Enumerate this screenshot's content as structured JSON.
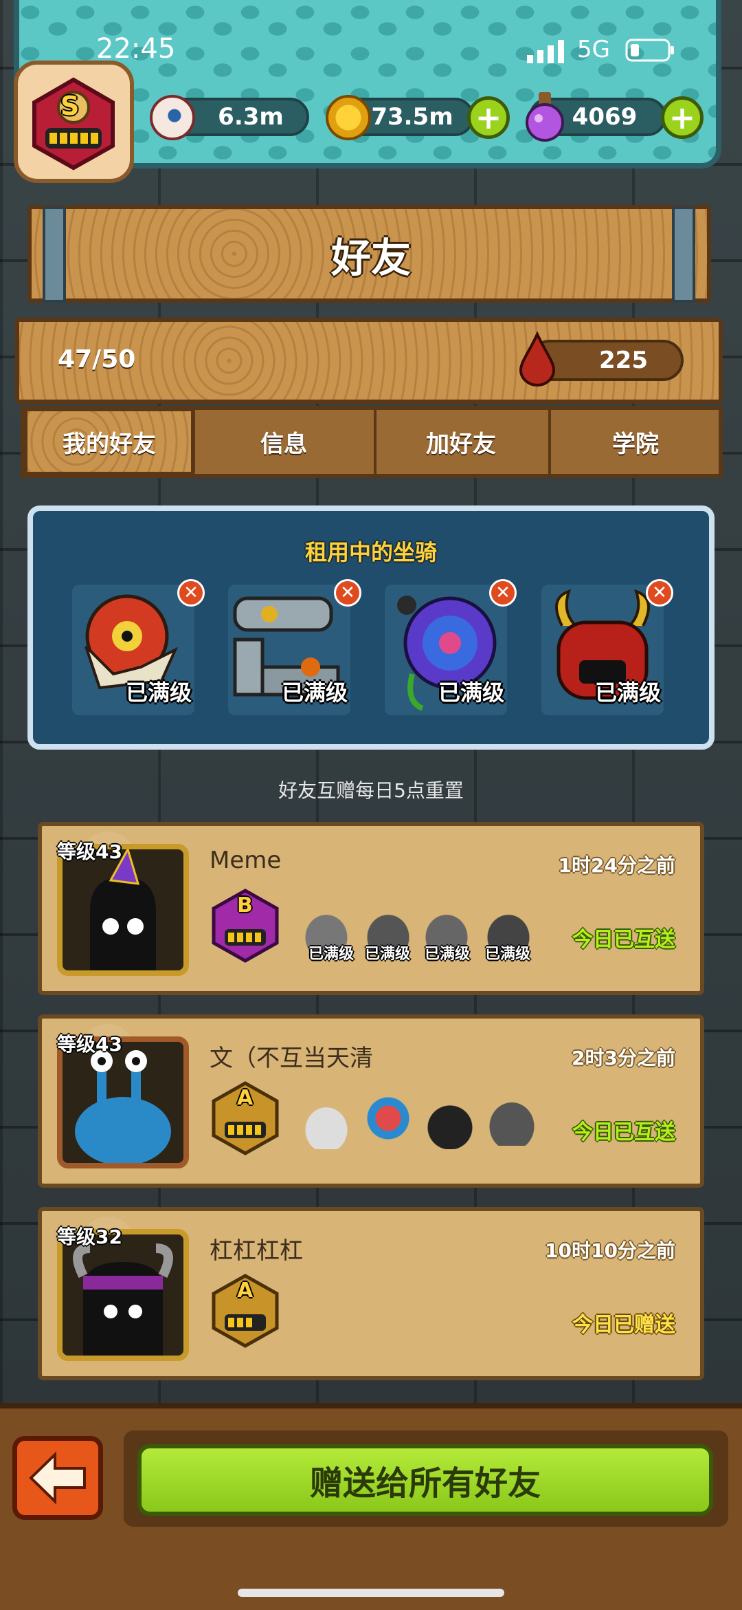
{
  "status_bar": {
    "time": "22:45",
    "network": "5G"
  },
  "player": {
    "rank_letter": "S"
  },
  "resources": [
    {
      "icon": "eyeball-icon",
      "value": "6.3m"
    },
    {
      "icon": "gold-coin-icon",
      "value": "73.5m"
    },
    {
      "icon": "potion-icon",
      "value": "4069"
    }
  ],
  "header": {
    "title": "好友"
  },
  "friends_summary": {
    "count": "47/50",
    "drops": "225"
  },
  "tabs": [
    {
      "label": "我的好友",
      "active": true
    },
    {
      "label": "信息",
      "active": false
    },
    {
      "label": "加好友",
      "active": false
    },
    {
      "label": "学院",
      "active": false
    }
  ],
  "rented_mounts": {
    "title": "租用中的坐骑",
    "items": [
      {
        "icon": "dragon-mount-icon",
        "label": "已满级"
      },
      {
        "icon": "machine-mount-icon",
        "label": "已满级"
      },
      {
        "icon": "rose-mount-icon",
        "label": "已满级"
      },
      {
        "icon": "demon-mount-icon",
        "label": "已满级"
      }
    ]
  },
  "reset_note": "好友互赠每日5点重置",
  "friends": [
    {
      "level": "等级43",
      "name": "Meme",
      "time": "1时24分之前",
      "rank": "B",
      "mount_labels": [
        "已满级",
        "已满级",
        "已满级",
        "已满级"
      ],
      "status": "今日已互送"
    },
    {
      "level": "等级43",
      "name": "文（不互当天清",
      "time": "2时3分之前",
      "rank": "A",
      "mount_labels": [
        "",
        "",
        "",
        ""
      ],
      "status": "今日已互送"
    },
    {
      "level": "等级32",
      "name": "杠杠杠杠",
      "time": "10时10分之前",
      "rank": "A",
      "mount_labels": [],
      "status": "今日已赠送"
    }
  ],
  "footer": {
    "send_all": "赠送给所有好友"
  },
  "colors": {
    "teal": "#5cc8c6",
    "wood": "#c9944d",
    "accent_green": "#9ad21c",
    "panel_blue": "#1f4d6b"
  }
}
